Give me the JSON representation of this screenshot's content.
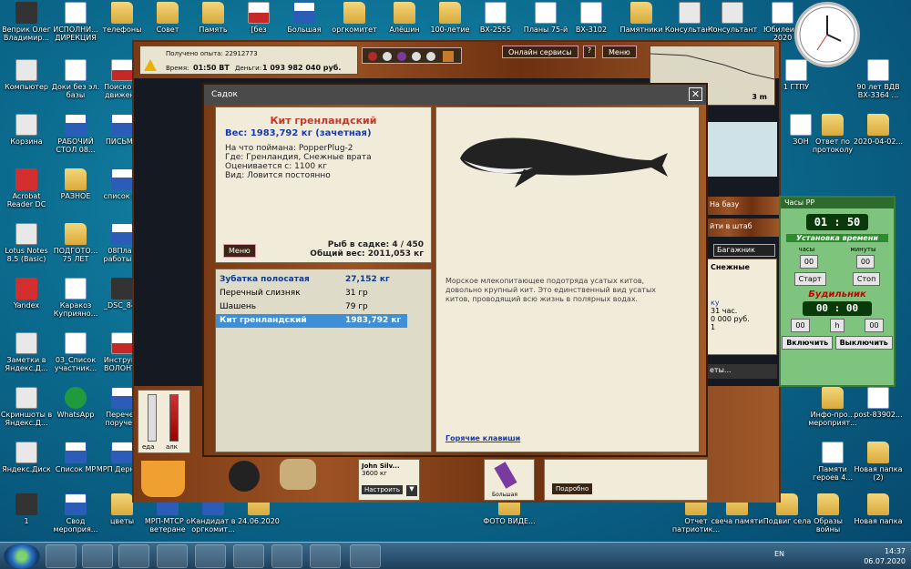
{
  "desktop_icons": [
    {
      "label": "Веприк Олег Владимир...",
      "type": "dark"
    },
    {
      "label": "ИСПОЛНИ... ДИРЕКЦИЯ",
      "type": "doc"
    },
    {
      "label": "телефоны",
      "type": "folder"
    },
    {
      "label": "Совет",
      "type": "folder"
    },
    {
      "label": "Память",
      "type": "folder"
    },
    {
      "label": "[без",
      "type": "pdf"
    },
    {
      "label": "Большая",
      "type": "word"
    },
    {
      "label": "оргкомитет",
      "type": "folder"
    },
    {
      "label": "Алёшин",
      "type": "folder"
    },
    {
      "label": "100-летие",
      "type": "folder"
    },
    {
      "label": "ВХ-2555",
      "type": "doc"
    },
    {
      "label": "Планы 75-й",
      "type": "doc"
    },
    {
      "label": "ВХ-3102",
      "type": "doc"
    },
    {
      "label": "Памятники",
      "type": "folder"
    },
    {
      "label": "Консультант",
      "type": "exe"
    },
    {
      "label": "Консультант",
      "type": "exe"
    },
    {
      "label": "Юбилеи В 2020",
      "type": "doc"
    },
    {
      "label": "Компьютер",
      "type": "exe"
    },
    {
      "label": "Доки без эл. базы",
      "type": "doc"
    },
    {
      "label": "Поисково движени",
      "type": "pdf"
    },
    {
      "label": "Корзина",
      "type": "exe"
    },
    {
      "label": "РАБОЧИЙ СТОЛ 08...",
      "type": "word"
    },
    {
      "label": "ПИСЬМО",
      "type": "word"
    },
    {
      "label": "Acrobat Reader DC",
      "type": "red"
    },
    {
      "label": "РАЗНОЕ",
      "type": "folder"
    },
    {
      "label": "список гл",
      "type": "word"
    },
    {
      "label": "Lotus Notes 8.5 (Basic)",
      "type": "exe"
    },
    {
      "label": "ПОДГОТО... 75 ЛЕТ",
      "type": "folder"
    },
    {
      "label": "08План работы ...",
      "type": "word"
    },
    {
      "label": "Yandex",
      "type": "red"
    },
    {
      "label": "Каракоз Куприяно...",
      "type": "doc"
    },
    {
      "label": "_DSC_847",
      "type": "dark"
    },
    {
      "label": "Заметки в Яндекс.Д...",
      "type": "exe"
    },
    {
      "label": "03_Список участник...",
      "type": "doc"
    },
    {
      "label": "Инструкц ВОЛОНТЕ",
      "type": "pdf"
    },
    {
      "label": "Скриншоты в Яндекс.Д...",
      "type": "exe"
    },
    {
      "label": "WhatsApp",
      "type": "green"
    },
    {
      "label": "Перечен порученi",
      "type": "word"
    },
    {
      "label": "Яндекс.Диск",
      "type": "exe"
    },
    {
      "label": "Список МР",
      "type": "word"
    },
    {
      "label": "МРП Дерново",
      "type": "word"
    },
    {
      "label": "1",
      "type": "dark"
    },
    {
      "label": "Свод мероприя...",
      "type": "word"
    },
    {
      "label": "цветы",
      "type": "folder"
    },
    {
      "label": "МРП-МТСР о ветеране",
      "type": "word"
    },
    {
      "label": "Кандидат в оргкомит...",
      "type": "word"
    },
    {
      "label": "24.06.2020",
      "type": "folder"
    },
    {
      "label": "ФОТО ВИДЕ...",
      "type": "folder"
    },
    {
      "label": "Отчет патриотик...",
      "type": "folder"
    },
    {
      "label": "свеча памяти",
      "type": "folder"
    },
    {
      "label": "Подвиг села",
      "type": "folder"
    },
    {
      "label": "Образы войны",
      "type": "folder"
    },
    {
      "label": "Новая папка",
      "type": "folder"
    },
    {
      "label": "90 лет ВДВ ВХ-3364 ...",
      "type": "doc"
    },
    {
      "label": "1 ГТПУ",
      "type": "doc"
    },
    {
      "label": "Ответ по протоколу",
      "type": "folder"
    },
    {
      "label": "2020-04-02...",
      "type": "folder"
    },
    {
      "label": "ЗОН",
      "type": "doc"
    },
    {
      "label": "Инфо-про... мероприят...",
      "type": "folder"
    },
    {
      "label": "post-83902...",
      "type": "doc"
    },
    {
      "label": "Памяти героев 4...",
      "type": "doc"
    },
    {
      "label": "Новая папка (2)",
      "type": "folder"
    }
  ],
  "game": {
    "exp_label": "Получено опыта: 22912773",
    "time_label": "Время:",
    "time_value": "01:50 ВТ",
    "money_label": "Деньги:",
    "money_value": "1 093 982 040 руб.",
    "online_label": "Онлайн сервисы",
    "help_label": "?",
    "menu_label": "Меню",
    "depth_label": "3 m",
    "right_labels": [
      "На базу",
      "йти в штаб",
      "Багажник",
      "Снежные",
      "ку",
      "31 час.",
      "0 000 руб.",
      "1",
      "еты..."
    ],
    "bottom": {
      "bucket_labels": [
        "еда",
        "алк"
      ],
      "card_name": "John Silv...",
      "card_weight": "3600 кг",
      "setup_label": "Настроить",
      "lure_label": "Большая",
      "details_label": "Подробно"
    }
  },
  "dialog": {
    "title": "Садок",
    "close": "✕",
    "fish_name": "Кит гренландский",
    "fish_weight": "Вес: 1983,792 кг (зачетная)",
    "caught_with": "На что поймана: PopperPlug-2",
    "where": "Где: Гренландия, Снежные врата",
    "rated_from": "Оценивается с: 1100 кг",
    "kind": "Вид: Ловится постоянно",
    "menu_button": "Меню",
    "fish_count": "Рыб в садке: 4 / 450",
    "total_weight": "Общий вес: 2011,053 кг",
    "fish_list": [
      {
        "name": "Зубатка полосатая",
        "weight": "27,152 кг"
      },
      {
        "name": "Перечный слизняк",
        "weight": "31 гр"
      },
      {
        "name": "Шашень",
        "weight": "79 гр"
      },
      {
        "name": "Кит гренландский",
        "weight": "1983,792 кг"
      }
    ],
    "description": "Морское млекопитающее подотряда усатых китов, довольно крупный кит. Это единственный вид усатых китов, проводящий всю жизнь в полярных водах.",
    "hotkeys_link": "Горячие клавиши"
  },
  "gadget": {
    "title": "Часы РР",
    "current_time": "01 : 50",
    "set_time_label": "Установка времени",
    "hours_label": "часы",
    "minutes_label": "минуты",
    "hours_value": "00",
    "minutes_value": "00",
    "start_label": "Старт",
    "stop_label": "Стоп",
    "alarm_label": "Будильник",
    "alarm_time": "00 : 00",
    "alarm_hours": "00",
    "alarm_minutes": "00",
    "on_label": "Включить",
    "off_label": "Выключить",
    "h_label": "h"
  },
  "taskbar": {
    "lang": "EN",
    "time": "14:37",
    "date": "06.07.2020"
  },
  "colors": {
    "accent": "#3f8ed8",
    "wood": "#8a4a1e",
    "fish_name": "#c0392b",
    "link": "#1a3aa8"
  }
}
